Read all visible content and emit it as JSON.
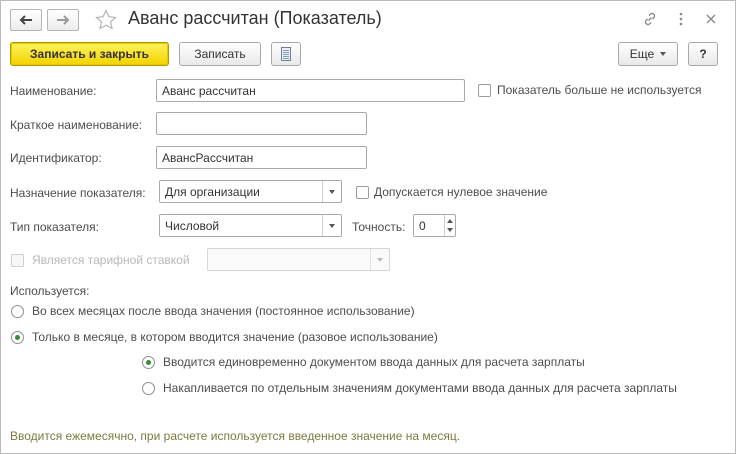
{
  "window": {
    "title": "Аванс рассчитан (Показатель)"
  },
  "toolbar": {
    "save_close_label": "Записать и закрыть",
    "save_label": "Записать",
    "more_label": "Еще",
    "help_label": "?"
  },
  "form": {
    "name_label": "Наименование:",
    "name_value": "Аванс рассчитан",
    "not_used_label": "Показатель больше не используется",
    "short_name_label": "Краткое наименование:",
    "short_name_value": "",
    "identifier_label": "Идентификатор:",
    "identifier_value": "АвансРассчитан",
    "purpose_label": "Назначение показателя:",
    "purpose_value": "Для организации",
    "zero_allowed_label": "Допускается нулевое значение",
    "type_label": "Тип показателя:",
    "type_value": "Числовой",
    "precision_label": "Точность:",
    "precision_value": "0",
    "tariff_label": "Является тарифной ставкой",
    "tariff_value": "",
    "usage_label": "Используется:",
    "usage_options": [
      "Во всех месяцах после ввода значения (постоянное использование)",
      "Только в месяце, в котором вводится значение (разовое использование)"
    ],
    "usage_selected": 1,
    "input_options": [
      "Вводится единовременно документом ввода данных для расчета зарплаты",
      "Накапливается по отдельным значениям документами ввода данных для расчета зарплаты"
    ],
    "input_selected": 0
  },
  "footer": {
    "note": "Вводится ежемесячно, при расчете используется введенное значение на месяц."
  },
  "colors": {
    "primary_button": "#f2d200",
    "note_text": "#7c7a3e",
    "radio_dot": "#3a8a3a"
  }
}
